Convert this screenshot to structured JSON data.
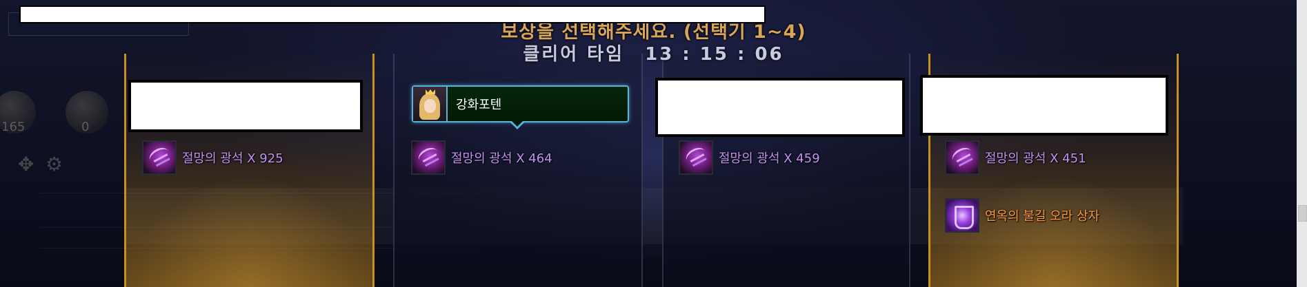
{
  "header": {
    "title": "보상을 선택해주세요. (선택기 1~4)",
    "clear_time_label": "클리어 타임",
    "clear_time_value": "13 : 15 : 06"
  },
  "tooltip": {
    "name": "강화포텐"
  },
  "columns": [
    {
      "highlighted": true,
      "items": [
        {
          "label": "절망의 광석 X 925",
          "icon": "despair-ore-icon"
        }
      ]
    },
    {
      "highlighted": false,
      "items": [
        {
          "label": "절망의 광석 X 464",
          "icon": "despair-ore-icon"
        }
      ]
    },
    {
      "highlighted": false,
      "items": [
        {
          "label": "절망의 광석 X 459",
          "icon": "despair-ore-icon"
        }
      ]
    },
    {
      "highlighted": true,
      "items": [
        {
          "label": "절망의 광석 X 451",
          "icon": "despair-ore-icon"
        },
        {
          "label": "연옥의 불길 오라 상자",
          "icon": "aura-box-icon"
        }
      ]
    }
  ],
  "background": {
    "left_counters": [
      "165",
      "0"
    ]
  },
  "colors": {
    "gold_border": "#c8901c",
    "item_purple": "#c493f2",
    "item_orange": "#ff9a3c",
    "tooltip_border": "#58b4d8"
  }
}
